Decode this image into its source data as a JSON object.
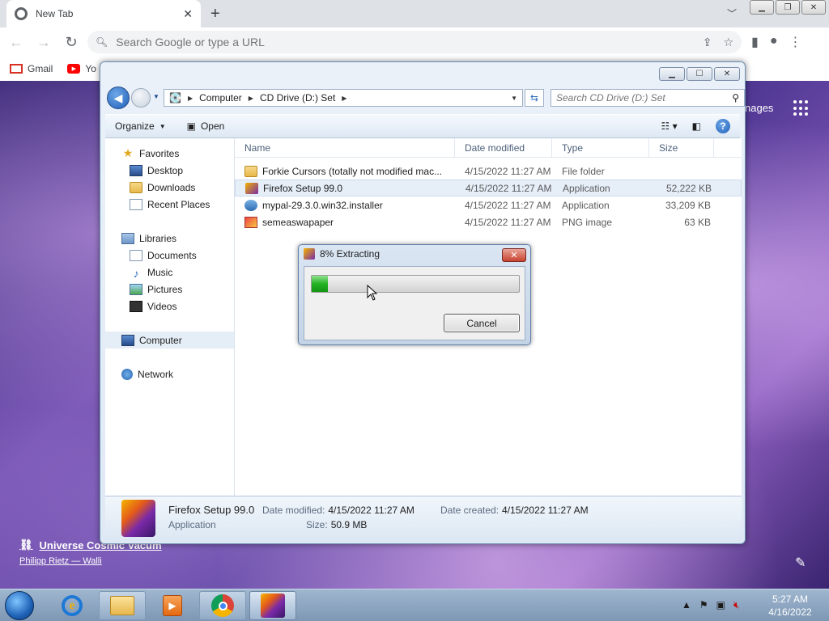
{
  "browser": {
    "tab_title": "New Tab",
    "omnibox_placeholder": "Search Google or type a URL",
    "bookmarks": [
      {
        "label": "Gmail"
      },
      {
        "label": "Yo"
      }
    ]
  },
  "newtab": {
    "images_link": "nages",
    "credit_title": "Universe Cosmic Vacum",
    "credit_author": "Philipp Rietz — Walli"
  },
  "explorer": {
    "breadcrumb": [
      "Computer",
      "CD Drive (D:) Set"
    ],
    "search_placeholder": "Search CD Drive (D:) Set",
    "cmd": {
      "organize": "Organize",
      "open": "Open"
    },
    "nav": {
      "favorites": "Favorites",
      "favorites_items": [
        "Desktop",
        "Downloads",
        "Recent Places"
      ],
      "libraries": "Libraries",
      "libraries_items": [
        "Documents",
        "Music",
        "Pictures",
        "Videos"
      ],
      "computer": "Computer",
      "network": "Network"
    },
    "columns": {
      "name": "Name",
      "date": "Date modified",
      "type": "Type",
      "size": "Size"
    },
    "files": [
      {
        "name": "Forkie Cursors (totally not modified mac...",
        "date": "4/15/2022 11:27 AM",
        "type": "File folder",
        "size": ""
      },
      {
        "name": "Firefox Setup 99.0",
        "date": "4/15/2022 11:27 AM",
        "type": "Application",
        "size": "52,222 KB"
      },
      {
        "name": "mypal-29.3.0.win32.installer",
        "date": "4/15/2022 11:27 AM",
        "type": "Application",
        "size": "33,209 KB"
      },
      {
        "name": "semeaswapaper",
        "date": "4/15/2022 11:27 AM",
        "type": "PNG image",
        "size": "63 KB"
      }
    ],
    "details": {
      "name": "Firefox Setup 99.0",
      "type": "Application",
      "modified_label": "Date modified:",
      "modified_value": "4/15/2022 11:27 AM",
      "created_label": "Date created:",
      "created_value": "4/15/2022 11:27 AM",
      "size_label": "Size:",
      "size_value": "50.9 MB"
    }
  },
  "dialog": {
    "title": "8% Extracting",
    "progress_percent": 8,
    "cancel_label": "Cancel"
  },
  "taskbar": {
    "time": "5:27 AM",
    "date": "4/16/2022"
  }
}
